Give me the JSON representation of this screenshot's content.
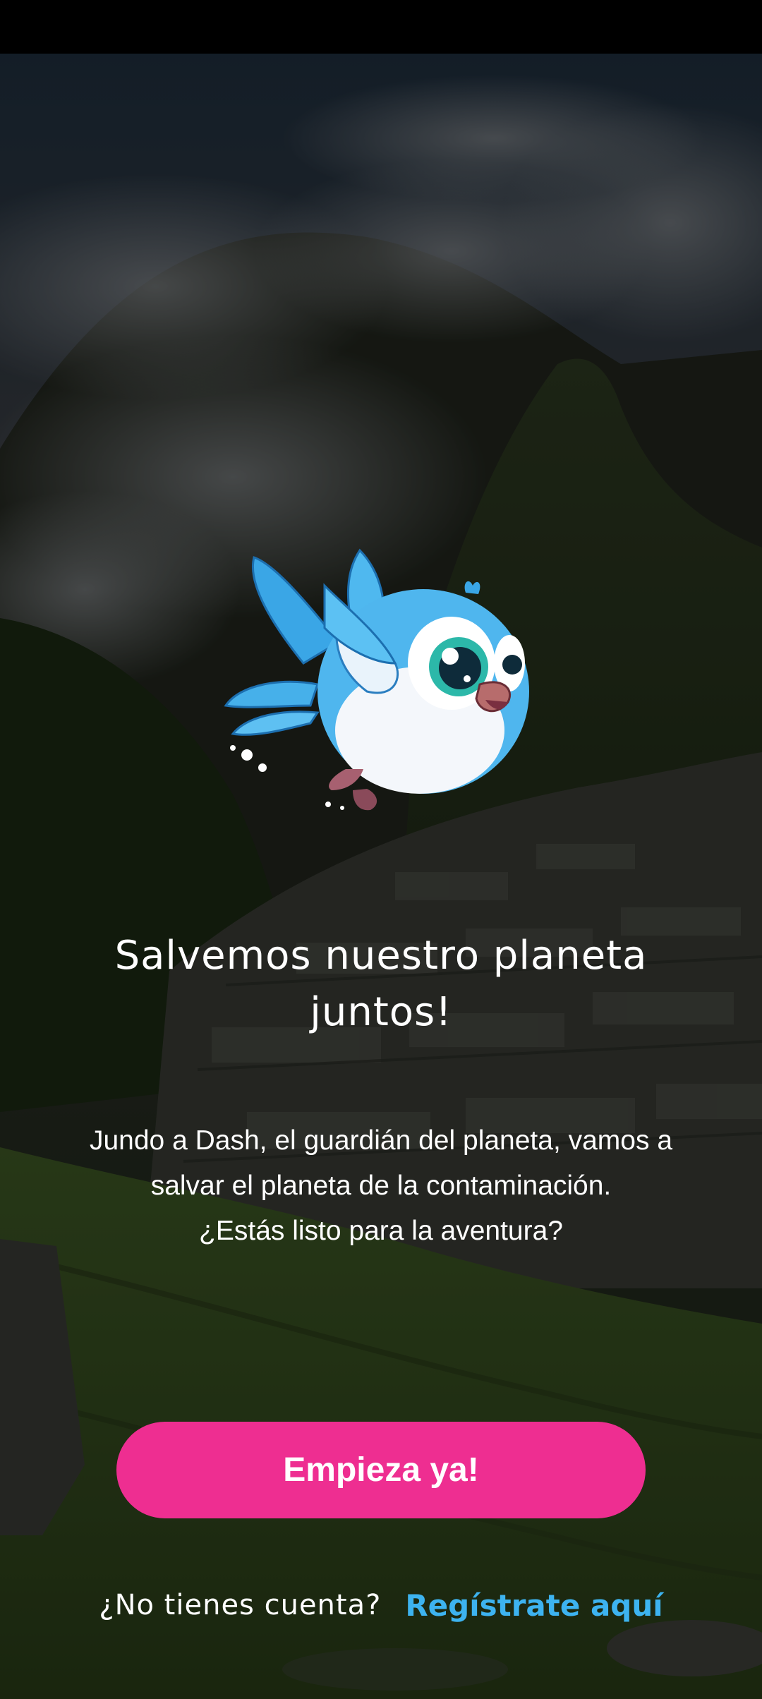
{
  "screen": {
    "title": [
      "Salvemos nuestro planeta",
      "juntos!"
    ],
    "description": [
      "Jundo a Dash, el guardián del planeta, vamos a",
      "salvar el planeta de la contaminación.",
      "¿Estás listo para la aventura?"
    ]
  },
  "actions": {
    "start_label": "Empieza ya!",
    "signup_prompt": "¿No tienes cuenta?",
    "signup_link": "Regístrate aquí"
  },
  "colors": {
    "accent": "#ee2e91",
    "link": "#3db3f0",
    "text": "#ffffff"
  },
  "images": {
    "background": "mountain-ruins-landscape",
    "mascot": "blue-bird-mascot"
  }
}
